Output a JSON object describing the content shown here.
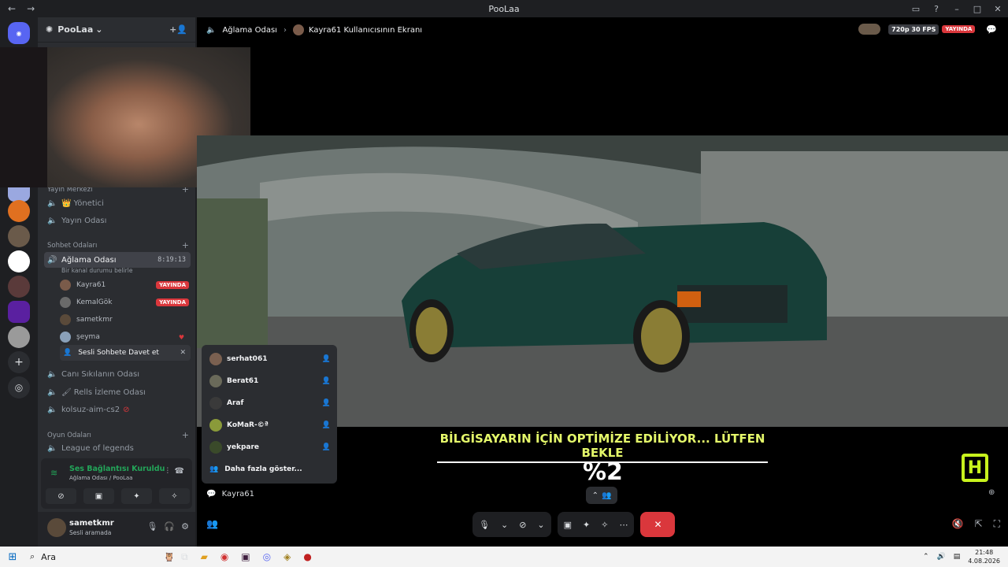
{
  "window": {
    "title": "PooLaa",
    "nav_back": "←",
    "nav_fwd": "→",
    "controls": [
      "▭",
      "?",
      "–",
      "□",
      "✕"
    ]
  },
  "guild": {
    "name": "PooLaa",
    "chevron": "⌄",
    "add_people_icon": "+👤"
  },
  "categories": {
    "yayin_merkezi": "Yayın Merkezi",
    "sohbet_odalari": "Sohbet Odaları",
    "oyun_odalari": "Oyun Odaları"
  },
  "channels": {
    "yonetici": "Yönetici",
    "yayin_odasi": "Yayın Odası",
    "aglama_odasi": "Ağlama Odası",
    "aglama_timer": "8:19:13",
    "aglama_status": "Bir kanal durumu belirle",
    "cani_sikilanin": "Canı Sıkılanın Odası",
    "rells": "Rells İzleme Odası",
    "kolsuz": "kolsuz-aim-cs2",
    "lol": "League of legends"
  },
  "voice_users": [
    {
      "name": "Kayra61",
      "badge": "YAYINDA",
      "color": "#7a5b4a"
    },
    {
      "name": "KemalGök",
      "badge": "YAYINDA",
      "color": "#6a6a6a"
    },
    {
      "name": "sametkmr",
      "badge": "",
      "color": "#5a4a3a"
    },
    {
      "name": "şeyma",
      "badge": "",
      "color": "#8aa0b8"
    }
  ],
  "invite": {
    "label": "Sesli Sohbete Davet et",
    "close": "✕"
  },
  "voice_panel": {
    "status": "Ses Bağlantısı Kuruldu",
    "sub": "Ağlama Odası / PooLaa"
  },
  "user_panel": {
    "name": "sametkmr",
    "status": "Sesli aramada"
  },
  "stage_header": {
    "channel": "Ağlama Odası",
    "screen": "Kayra61 Kullanıcısının Ekranı",
    "quality": "720p 30 FPS",
    "live": "YAYINDA"
  },
  "stream_overlay": {
    "message": "BİLGİSAYARIN İÇİN OPTİMİZE EDİLİYOR... LÜTFEN BEKLE",
    "percent": "%2",
    "logo": "H"
  },
  "invite_popup": {
    "users": [
      {
        "name": "serhat061",
        "color": "#7a6050"
      },
      {
        "name": "Berat61",
        "color": "#6a6a5a"
      },
      {
        "name": "Araf",
        "color": "#3a3a3a"
      },
      {
        "name": "KoMaR-©ª",
        "color": "#8a9a3a"
      },
      {
        "name": "yekpare",
        "color": "#3a4a2a"
      }
    ],
    "more": "Daha fazla göster..."
  },
  "caption_user": "Kayra61",
  "taskbar": {
    "search": "Ara",
    "time": "21:48",
    "date": "4.08.2026"
  },
  "colors": {
    "accent_green": "#23a559",
    "live_red": "#da373c",
    "overlay_yellow": "#e4f76a"
  }
}
